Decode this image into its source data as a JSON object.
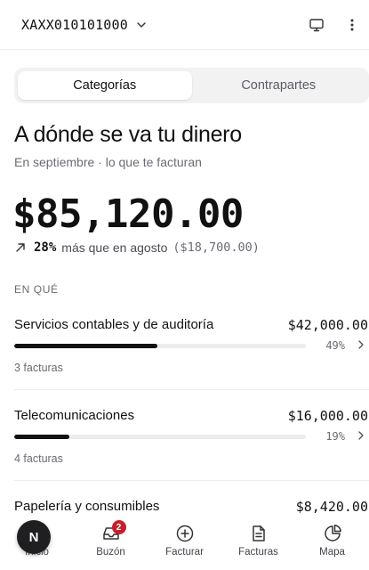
{
  "header": {
    "account_id": "XAXX010101000",
    "icons": [
      "chevron-down-icon",
      "monitor-icon",
      "more-vertical-icon"
    ]
  },
  "tabs": [
    {
      "label": "Categorías",
      "active": true
    },
    {
      "label": "Contrapartes",
      "active": false
    }
  ],
  "summary": {
    "title": "A dónde se va tu dinero",
    "subtitle": "En septiembre · lo que te facturan",
    "total": "$85,120.00",
    "change_pct": "28%",
    "change_text": "más que en agosto",
    "previous": "($18,700.00)"
  },
  "section_label": "EN QUÉ",
  "categories": [
    {
      "name": "Servicios contables y de auditoría",
      "amount": "$42,000.00",
      "percent_label": "49%",
      "share": 0.49,
      "count": "3 facturas"
    },
    {
      "name": "Telecomunicaciones",
      "amount": "$16,000.00",
      "percent_label": "19%",
      "share": 0.19,
      "count": "4 facturas"
    },
    {
      "name": "Papelería y consumibles",
      "amount": "$8,420.00"
    }
  ],
  "nav": {
    "items": [
      {
        "label": "Inicio",
        "icon": "home-icon"
      },
      {
        "label": "Buzón",
        "icon": "inbox-icon",
        "badge": "2"
      },
      {
        "label": "Facturar",
        "icon": "plus-circle-icon"
      },
      {
        "label": "Facturas",
        "icon": "document-icon"
      },
      {
        "label": "Mapa",
        "icon": "pie-chart-icon"
      }
    ],
    "avatar_initial": "N"
  },
  "colors": {
    "accent": "#111111",
    "badge": "#c8202b",
    "track": "#ececef"
  }
}
